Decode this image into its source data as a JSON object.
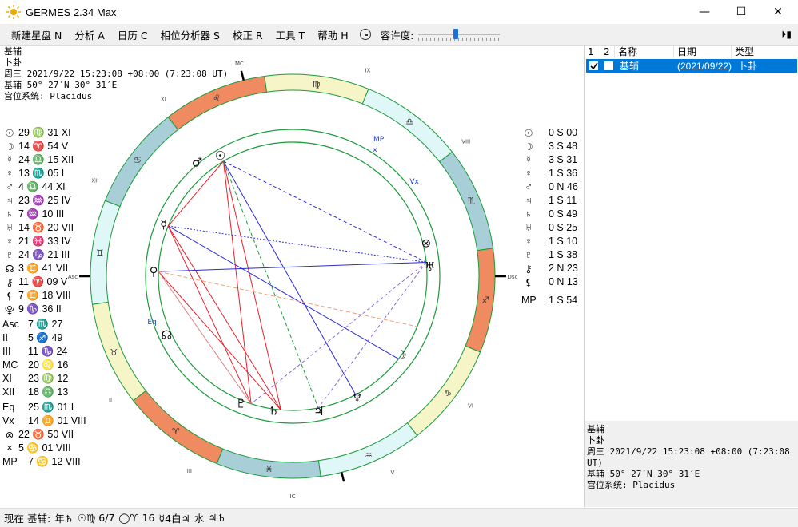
{
  "window": {
    "title": "GERMES 2.34 Max",
    "minimize": "—",
    "maximize": "☐",
    "close": "✕"
  },
  "menu": {
    "items": [
      "新建星盘 N",
      "分析 A",
      "日历 C",
      "相位分析器 S",
      "校正 R",
      "工具 T",
      "帮助 H"
    ],
    "tolerance_label": "容许度:",
    "tolerance_fraction": 0.45,
    "expand_glyph": "⏵▮"
  },
  "chart_info": {
    "name": "基辅",
    "type": "卜卦",
    "datetime": "周三 2021/9/22 15:23:08 +08:00 (7:23:08 UT)",
    "location": "基辅 50° 27′N 30° 31′E",
    "house_system": "宫位系统: Placidus"
  },
  "positions": [
    {
      "g": "☉",
      "v": "29 ♍ 31  XI"
    },
    {
      "g": "☽",
      "v": "14 ♈ 54  V"
    },
    {
      "g": "☿",
      "v": "24 ♎ 15  XII"
    },
    {
      "g": "♀",
      "v": "13 ♏ 05  I"
    },
    {
      "g": "♂",
      "v": "4 ♎ 44  XI"
    },
    {
      "g": "♃",
      "v": "23 ♒ 25  IV"
    },
    {
      "g": "♄",
      "v": "7 ♒ 10  III"
    },
    {
      "g": "♅",
      "v": "14 ♉ 20  VII"
    },
    {
      "g": "♆",
      "v": "21 ♓ 33  IV"
    },
    {
      "g": "♇",
      "v": "24 ♑ 21  III"
    },
    {
      "g": "☊",
      "v": "3 ♊ 41  VII"
    },
    {
      "g": "⚷",
      "v": "11 ♈ 09  V"
    },
    {
      "g": "⚸",
      "v": "7 ♊ 18  VIII"
    },
    {
      "g": "⯓",
      "v": "9 ♑ 36  II"
    },
    {
      "g": "Asc",
      "v": "7 ♏ 27"
    },
    {
      "g": "II",
      "v": "5 ♐ 49"
    },
    {
      "g": "III",
      "v": "11 ♑ 24"
    },
    {
      "g": "MC",
      "v": "20 ♌ 16"
    },
    {
      "g": "XI",
      "v": "23 ♍ 12"
    },
    {
      "g": "XII",
      "v": "18 ♎ 13"
    },
    {
      "g": "Eq",
      "v": "25 ♏ 01  I"
    },
    {
      "g": "Vx",
      "v": "14 ♊ 01  VIII"
    },
    {
      "g": "⊗",
      "v": "22 ♉ 50  VII"
    },
    {
      "g": "×",
      "v": "5 ♋ 01  VIII"
    },
    {
      "g": "MP",
      "v": "7 ♋ 12  VIII"
    }
  ],
  "declinations": [
    {
      "g": "☉",
      "v": "0 S 00"
    },
    {
      "g": "☽",
      "v": "3 S 48"
    },
    {
      "g": "☿",
      "v": "3 S 31"
    },
    {
      "g": "♀",
      "v": "1 S 36"
    },
    {
      "g": "♂",
      "v": "0 N 46"
    },
    {
      "g": "♃",
      "v": "1 S 11"
    },
    {
      "g": "♄",
      "v": "0 S 49"
    },
    {
      "g": "♅",
      "v": "0 S 25"
    },
    {
      "g": "♆",
      "v": "1 S 10"
    },
    {
      "g": "♇",
      "v": "1 S 38"
    },
    {
      "g": "⚷",
      "v": "2 N 23"
    },
    {
      "g": "⚸",
      "v": "0 N 13"
    },
    {
      "g": "MP",
      "v": "1 S 54"
    }
  ],
  "wheel": {
    "house_labels": [
      "IX",
      "VIII",
      "Dsc",
      "VI",
      "V",
      "IC",
      "III",
      "II",
      "Asc",
      "XII",
      "XI",
      "MC"
    ],
    "point_labels": [
      "MP",
      "×",
      "Vx",
      "Eq"
    ],
    "signs": [
      "♌",
      "♋",
      "♊",
      "♉",
      "♈",
      "♓",
      "♒",
      "♑",
      "♐",
      "♏",
      "♎",
      "♍"
    ]
  },
  "list": {
    "headers": [
      "1",
      "2",
      "名称",
      "日期",
      "类型"
    ],
    "row": {
      "name": "基辅",
      "date": "(2021/09/22)",
      "type": "卜卦"
    }
  },
  "bottom_pane": {
    "name": "基辅",
    "type": "卜卦",
    "datetime": "周三 2021/9/22 15:23:08 +08:00 (7:23:08 UT)",
    "location": "基辅 50° 27′N 30° 31′E",
    "house_system": "宫位系统: Placidus"
  },
  "status": {
    "label": "现在 基辅:",
    "items": [
      "年♄",
      "☉♍ 6/7",
      "◯♈ 16",
      "☿4白♃",
      "水",
      "♃♄"
    ]
  },
  "colors": {
    "selection": "#0078d7",
    "aspect_red": "#e8202a",
    "aspect_blue": "#2a2ad8",
    "aspect_green": "#1a9a3a",
    "fire": "#f08a60",
    "earth": "#f5f5c8",
    "air": "#dff7f7",
    "water": "#a8cfd8"
  }
}
